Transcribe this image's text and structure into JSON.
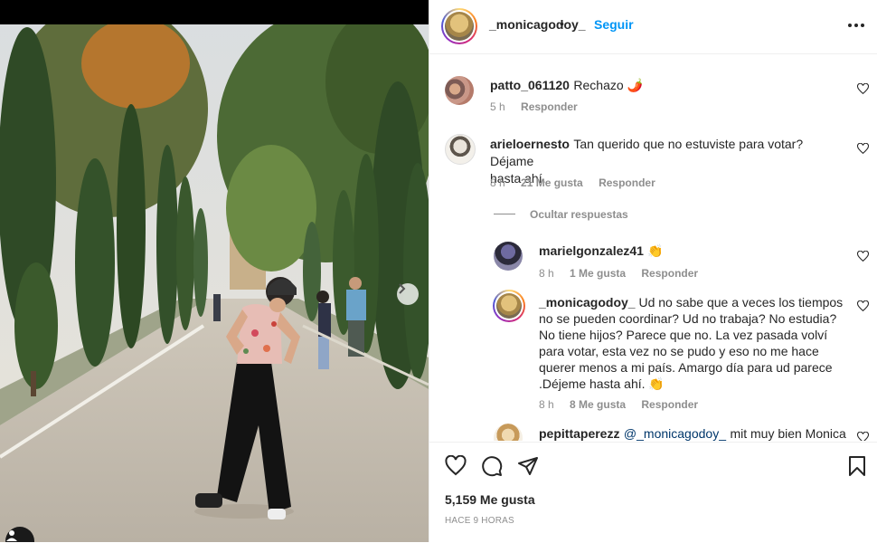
{
  "post": {
    "username": "_monicagodoy_",
    "separator": "•",
    "follow_label": "Seguir",
    "likes_text": "5,159 Me gusta",
    "time_ago": "HACE 9 HORAS"
  },
  "comments": [
    {
      "user": "patto_061120",
      "text": "Rechazo 🌶️",
      "time": "5 h",
      "likes": "",
      "reply": "Responder"
    },
    {
      "user": "arieloernesto",
      "text": "Tan querido que no estuviste para votar? Déjame",
      "text2": "hasta ahí.",
      "time": "8 h",
      "likes": "21 Me gusta",
      "reply": "Responder"
    }
  ],
  "hide_replies": "Ocultar respuestas",
  "replies": [
    {
      "user": "marielgonzalez41",
      "text": "👏",
      "time": "8 h",
      "likes": "1 Me gusta",
      "reply": "Responder"
    },
    {
      "user": "_monicagodoy_",
      "lines": [
        "Ud no sabe que a veces los tiempos",
        "no se pueden coordinar? Ud no trabaja? No estudia?",
        "No tiene hijos? Parece que no. La vez pasada volví",
        "para votar, esta vez no se pudo y eso no me hace",
        "querer menos a mi país. Amargo día para ud parece",
        ".Déjeme hasta ahí. 👏"
      ],
      "time": "8 h",
      "likes": "8 Me gusta",
      "reply": "Responder"
    },
    {
      "user": "pepittaperezz",
      "mention": "@_monicagodoy_",
      "text": "mit muy bien Monica"
    }
  ],
  "colors": {
    "accent": "#0095f6",
    "muted": "#8e8e8e",
    "text": "#262626"
  },
  "icons": [
    "more-icon",
    "heart-icon",
    "comment-icon",
    "share-icon",
    "bookmark-icon",
    "chevron-right-icon",
    "user-tag-icon"
  ]
}
